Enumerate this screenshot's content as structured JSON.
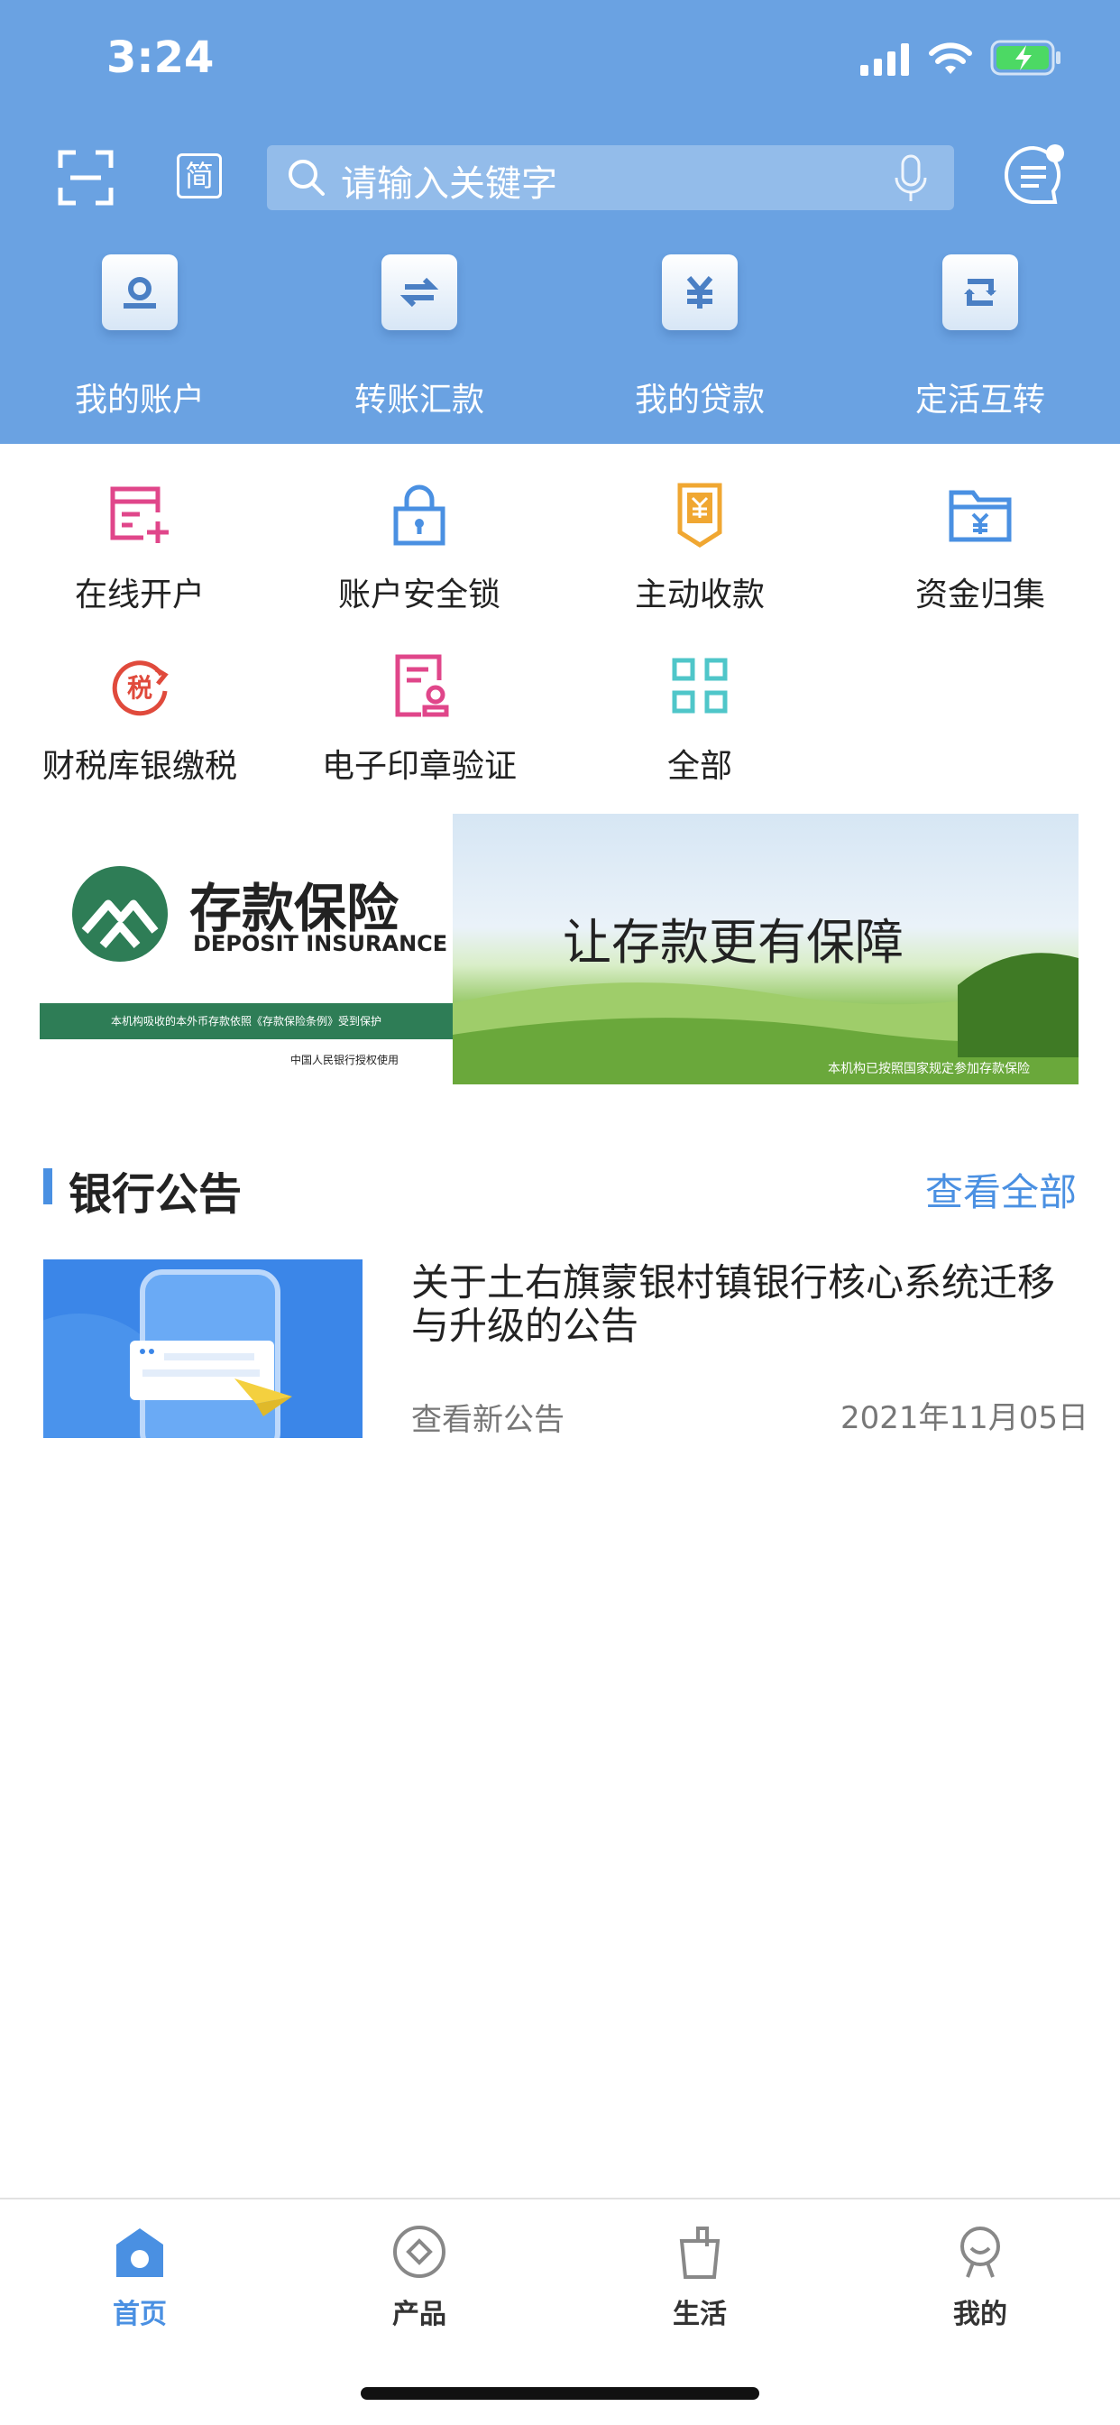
{
  "status_bar": {
    "time": "3:24"
  },
  "header": {
    "lang_label": "简",
    "search_placeholder": "请输入关键字",
    "quick_actions": [
      {
        "label": "我的账户",
        "icon": "account-icon"
      },
      {
        "label": "转账汇款",
        "icon": "transfer-icon"
      },
      {
        "label": "我的贷款",
        "icon": "loan-icon"
      },
      {
        "label": "定活互转",
        "icon": "exchange-icon"
      }
    ]
  },
  "services": [
    {
      "label": "在线开户",
      "icon": "online-account-icon"
    },
    {
      "label": "账户安全锁",
      "icon": "lock-icon"
    },
    {
      "label": "主动收款",
      "icon": "collect-payment-icon"
    },
    {
      "label": "资金归集",
      "icon": "fund-folder-icon"
    },
    {
      "label": "财税库银缴税",
      "icon": "tax-icon"
    },
    {
      "label": "电子印章验证",
      "icon": "seal-verify-icon"
    },
    {
      "label": "全部",
      "icon": "grid-icon"
    }
  ],
  "banner": {
    "brand_cn": "存款保险",
    "brand_en": "DEPOSIT INSURANCE",
    "strip_text": "本机构吸收的本外币存款依照《存款保险条例》受到保护",
    "authorized": "中国人民银行授权使用",
    "slogan": "让存款更有保障",
    "footnote": "本机构已按照国家规定参加存款保险"
  },
  "announcements": {
    "title": "银行公告",
    "more": "查看全部",
    "items": [
      {
        "title": "关于土右旗蒙银村镇银行核心系统迁移与升级的公告",
        "sub": "查看新公告",
        "date": "2021年11月05日"
      }
    ]
  },
  "tabbar": [
    {
      "label": "首页",
      "icon": "home-icon",
      "active": true
    },
    {
      "label": "产品",
      "icon": "product-icon",
      "active": false
    },
    {
      "label": "生活",
      "icon": "life-icon",
      "active": false
    },
    {
      "label": "我的",
      "icon": "profile-icon",
      "active": false
    }
  ],
  "colors": {
    "header": "#6aa2e2",
    "accent": "#4a90e2",
    "pink": "#e0468a",
    "orange": "#f0a732",
    "teal": "#4fc6c9",
    "red": "#e04a3c"
  }
}
